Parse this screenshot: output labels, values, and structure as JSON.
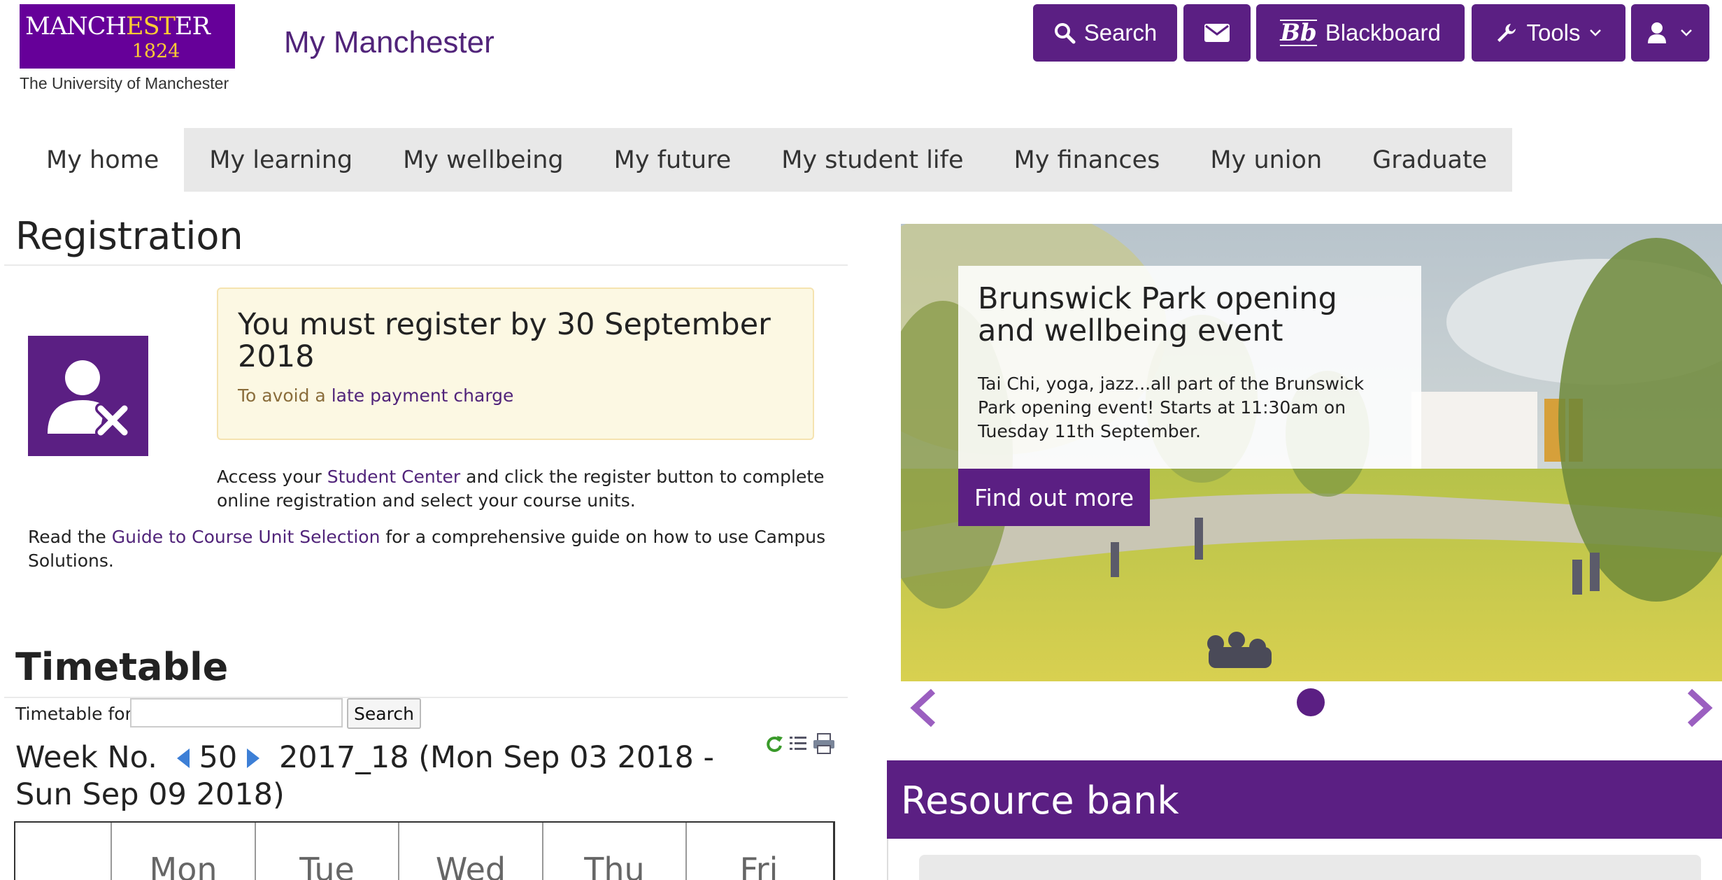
{
  "header": {
    "logo": {
      "word_part1": "MANCH",
      "word_gold": "EST",
      "word_part2": "ER",
      "year": "1824",
      "subtitle": "The University of Manchester"
    },
    "site_title": "My Manchester",
    "buttons": {
      "search": "Search",
      "blackboard": "Blackboard",
      "tools": "Tools"
    }
  },
  "nav": {
    "items": [
      {
        "label": "My home"
      },
      {
        "label": "My learning"
      },
      {
        "label": "My wellbeing"
      },
      {
        "label": "My future"
      },
      {
        "label": "My student life"
      },
      {
        "label": "My finances"
      },
      {
        "label": "My union"
      },
      {
        "label": "Graduate"
      }
    ]
  },
  "registration": {
    "heading": "Registration",
    "notice_title": "You must register by 30 September 2018",
    "notice_prefix": "To avoid a ",
    "notice_link": "late payment charge",
    "access_prefix": "Access your ",
    "access_link": "Student Center",
    "access_suffix": " and click the register button to complete online registration and select your course units.",
    "read_prefix": "Read the ",
    "read_link": "Guide to Course Unit Selection",
    "read_suffix": " for a comprehensive guide on how to use Campus Solutions."
  },
  "timetable": {
    "heading": "Timetable",
    "label": "Timetable for",
    "input_value": "",
    "search_label": "Search",
    "week_prefix": "Week No.",
    "week_number": "50",
    "week_range": "2017_18 (Mon Sep 03 2018 - Sun Sep 09 2018)",
    "days": [
      "",
      "Mon",
      "Tue",
      "Wed",
      "Thu",
      "Fri"
    ]
  },
  "promo": {
    "title": "Brunswick Park opening and wellbeing event",
    "text": "Tai Chi, yoga, jazz...all part of the Brunswick Park opening event! Starts at 11:30am on Tuesday 11th September.",
    "button": "Find out more"
  },
  "resource_bank": {
    "title": "Resource bank"
  },
  "colors": {
    "brand_purple": "#5b1f83",
    "logo_purple": "#660099",
    "logo_gold": "#ffcc33",
    "notice_bg": "#fcf8e3"
  }
}
